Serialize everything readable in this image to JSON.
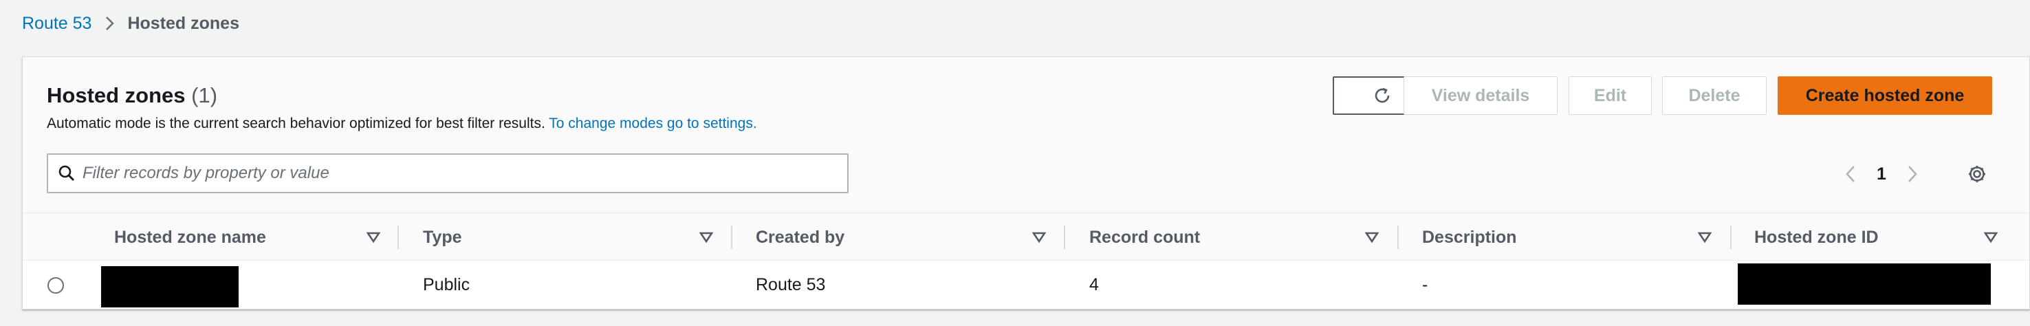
{
  "breadcrumb": {
    "root": "Route 53",
    "current": "Hosted zones"
  },
  "header": {
    "title": "Hosted zones",
    "count": "(1)",
    "description": "Automatic mode is the current search behavior optimized for best filter results.",
    "settings_link": "To change modes go to settings."
  },
  "actions": {
    "view_details": "View details",
    "edit": "Edit",
    "delete": "Delete",
    "create": "Create hosted zone"
  },
  "search": {
    "placeholder": "Filter records by property or value"
  },
  "pagination": {
    "current_page": "1"
  },
  "table": {
    "columns": [
      "Hosted zone name",
      "Type",
      "Created by",
      "Record count",
      "Description",
      "Hosted zone ID"
    ],
    "rows": [
      {
        "name": "",
        "type": "Public",
        "created_by": "Route 53",
        "record_count": "4",
        "description": "-",
        "zone_id": ""
      }
    ]
  },
  "colors": {
    "link": "#0073bb",
    "primary_button": "#ec7211",
    "disabled_text": "#aab7b8"
  }
}
